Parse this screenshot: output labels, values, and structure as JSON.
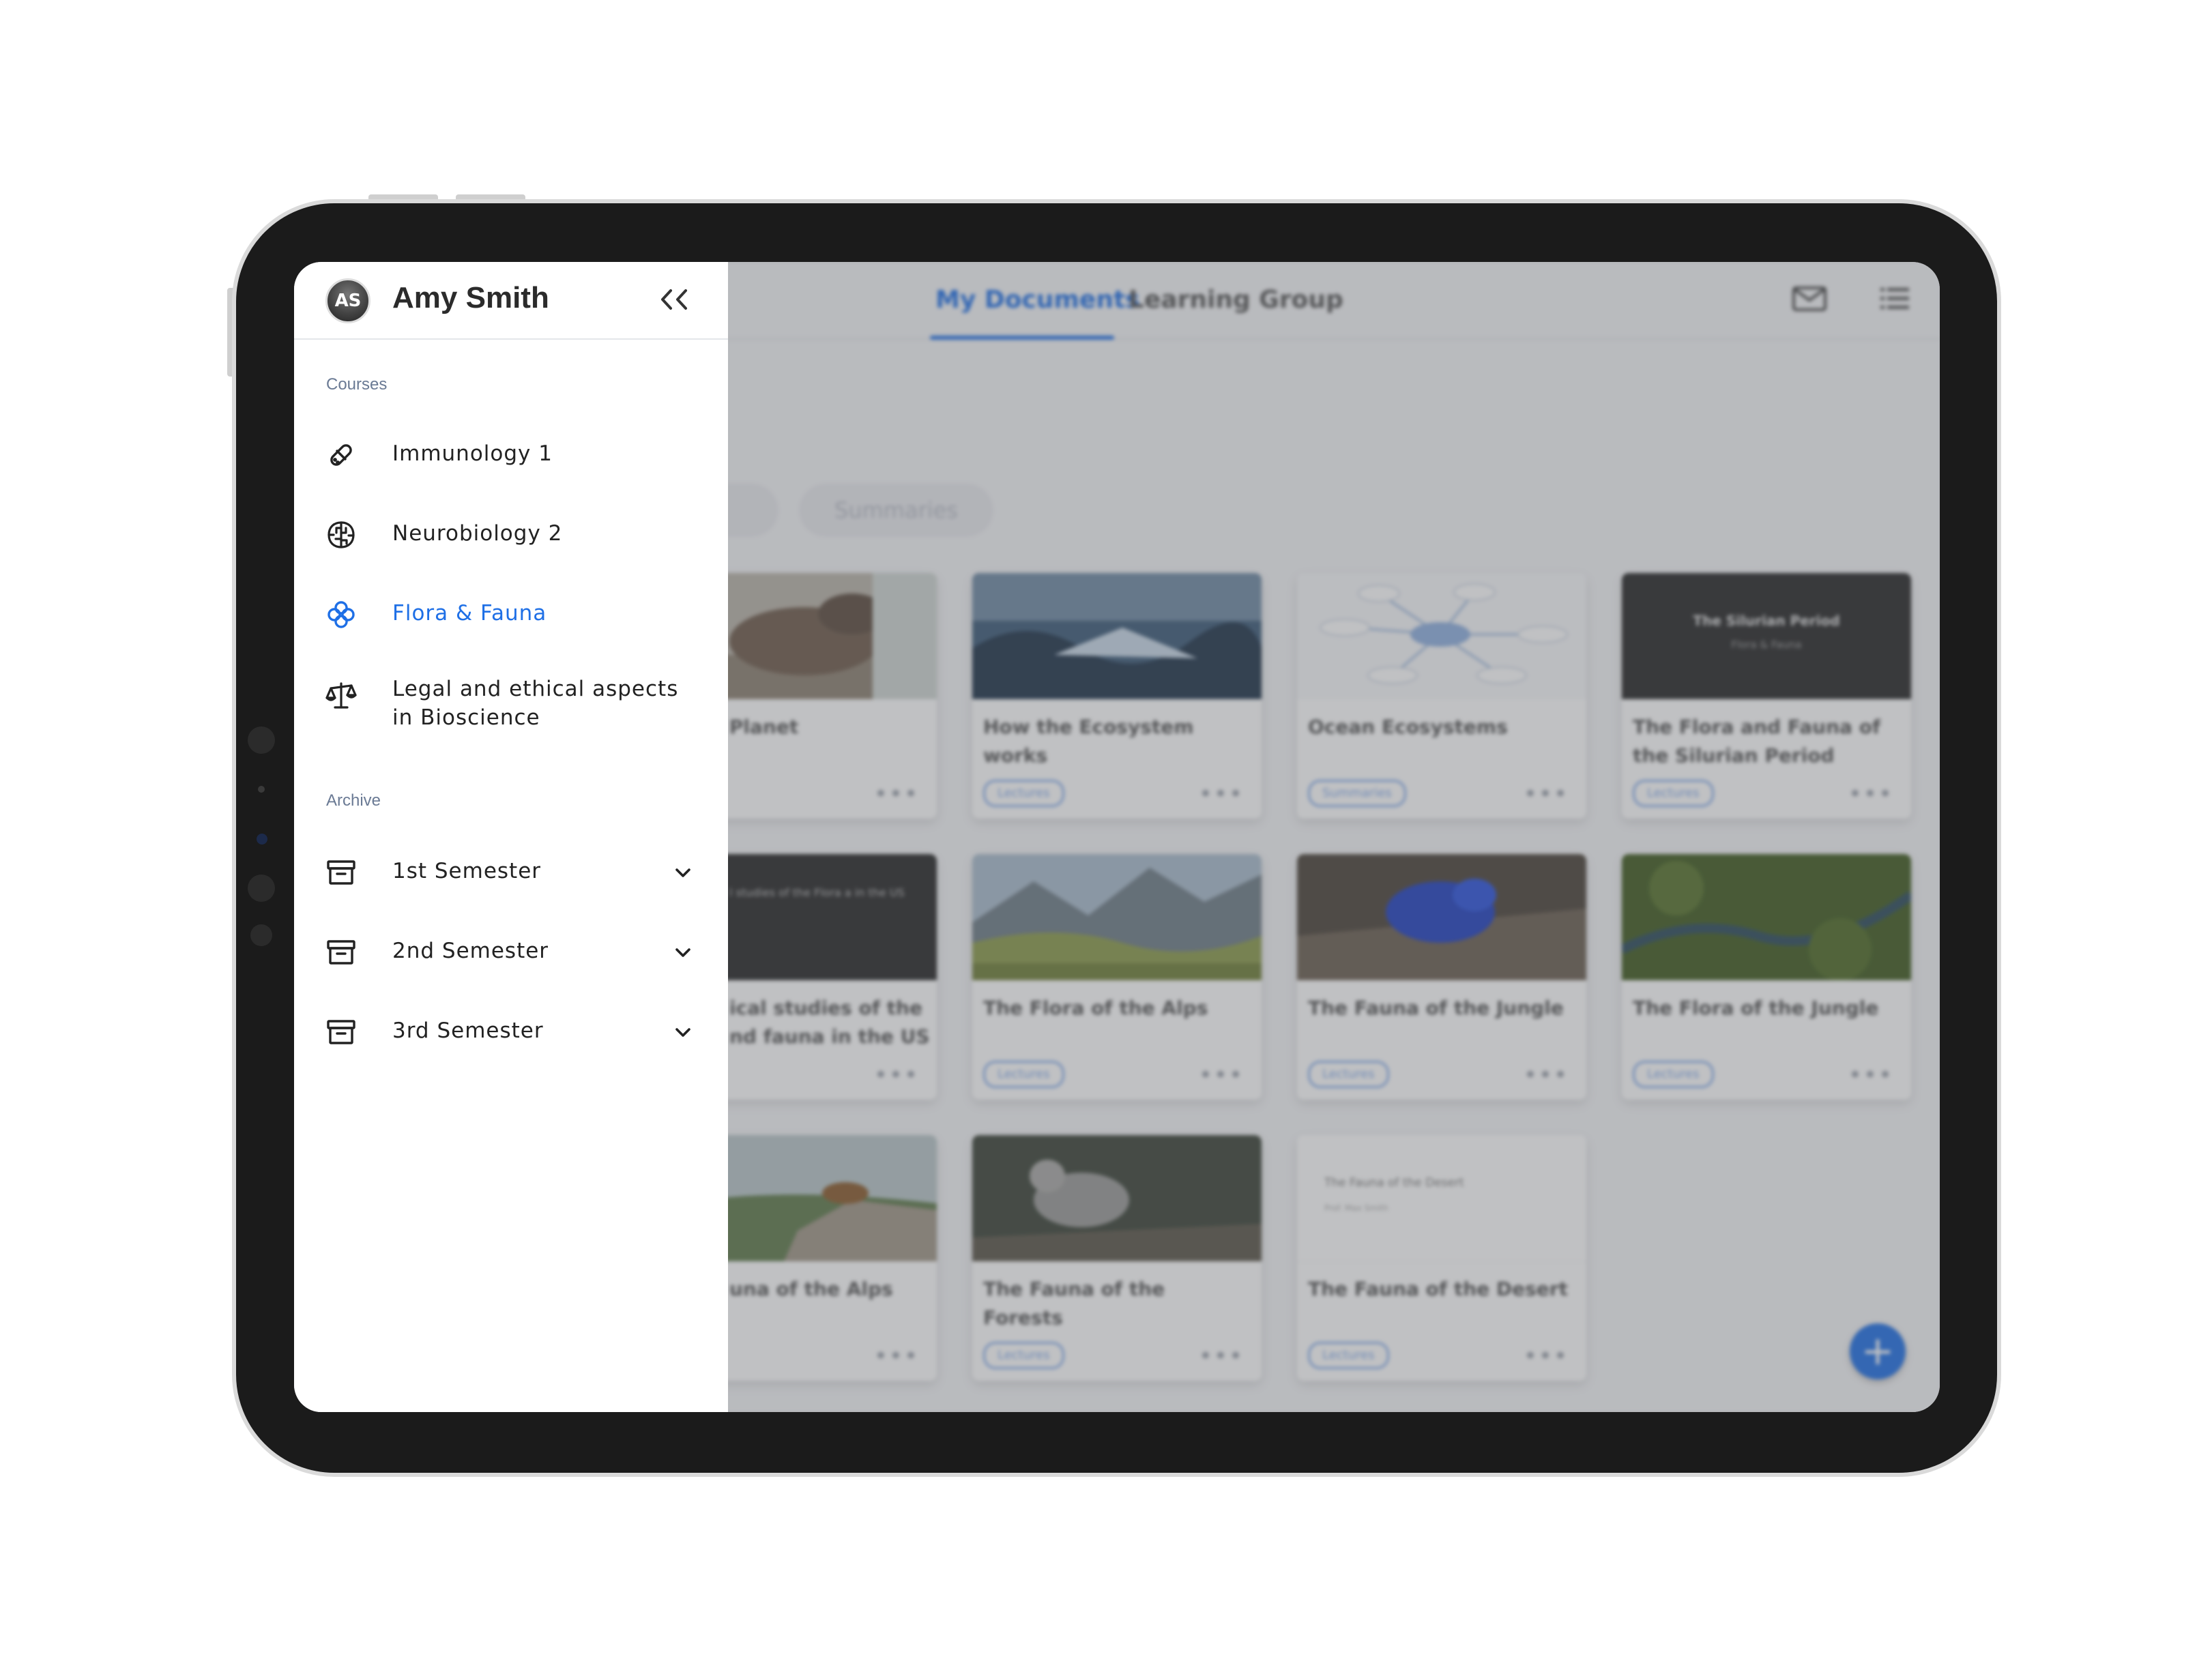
{
  "colors": {
    "accent": "#1e6fe6",
    "text": "#222222",
    "section": "#6a7a94"
  },
  "drawer": {
    "user_initials": "AS",
    "user_name": "Amy Smith",
    "collapse_label": "<<",
    "courses_label": "Courses",
    "courses": [
      {
        "label": "Immunology 1",
        "icon": "pill-icon"
      },
      {
        "label": "Neurobiology 2",
        "icon": "brain-icon"
      },
      {
        "label": "Flora & Fauna",
        "icon": "flower-icon",
        "active": true
      },
      {
        "label": "Legal and ethical aspects in Bioscience",
        "icon": "scale-icon"
      }
    ],
    "archive_label": "Archive",
    "archive": [
      {
        "label": "1st Semester",
        "icon": "archive-box-icon"
      },
      {
        "label": "2nd Semester",
        "icon": "archive-box-icon"
      },
      {
        "label": "3rd Semester",
        "icon": "archive-box-icon"
      }
    ]
  },
  "main": {
    "tabs": [
      {
        "label": "My Documents",
        "active": true
      },
      {
        "label": "Learning Group"
      }
    ],
    "filters": [
      "Summaries"
    ],
    "cards": [
      {
        "title": "of our Planet",
        "tag": "",
        "thumb": "dinosaur"
      },
      {
        "title": "How the Ecosystem works",
        "tag": "Lectures",
        "thumb": "glacier"
      },
      {
        "title": "Ocean Ecosystems",
        "tag": "Summaries",
        "thumb": "mindmap"
      },
      {
        "title": "The Flora and Fauna of the Silurian Period",
        "tag": "Lectures",
        "thumb": "slide-dark",
        "slide_title": "The Silurian Period",
        "slide_subtitle": "Flora & Fauna"
      },
      {
        "title": "ical studies of the nd fauna in the US",
        "tag": "",
        "thumb": "slide-dark",
        "slide_title": "l studies of the Flora a in the US",
        "slide_subtitle": ""
      },
      {
        "title": "The Flora of the Alps",
        "tag": "Lectures",
        "thumb": "mountains"
      },
      {
        "title": "The Fauna of the Jungle",
        "tag": "Lectures",
        "thumb": "frog"
      },
      {
        "title": "The Flora of the Jungle",
        "tag": "Lectures",
        "thumb": "forest"
      },
      {
        "title": "una of the Alps",
        "tag": "",
        "thumb": "alps-animal"
      },
      {
        "title": "The Fauna of the Forests",
        "tag": "Lectures",
        "thumb": "wolf"
      },
      {
        "title": "The Fauna of the Desert",
        "tag": "Lectures",
        "thumb": "slide-light",
        "slide_title": "The Fauna of the Desert",
        "slide_subtitle": "Prof. Max Smith"
      }
    ],
    "more_label": "•••",
    "fab_label": "+"
  }
}
